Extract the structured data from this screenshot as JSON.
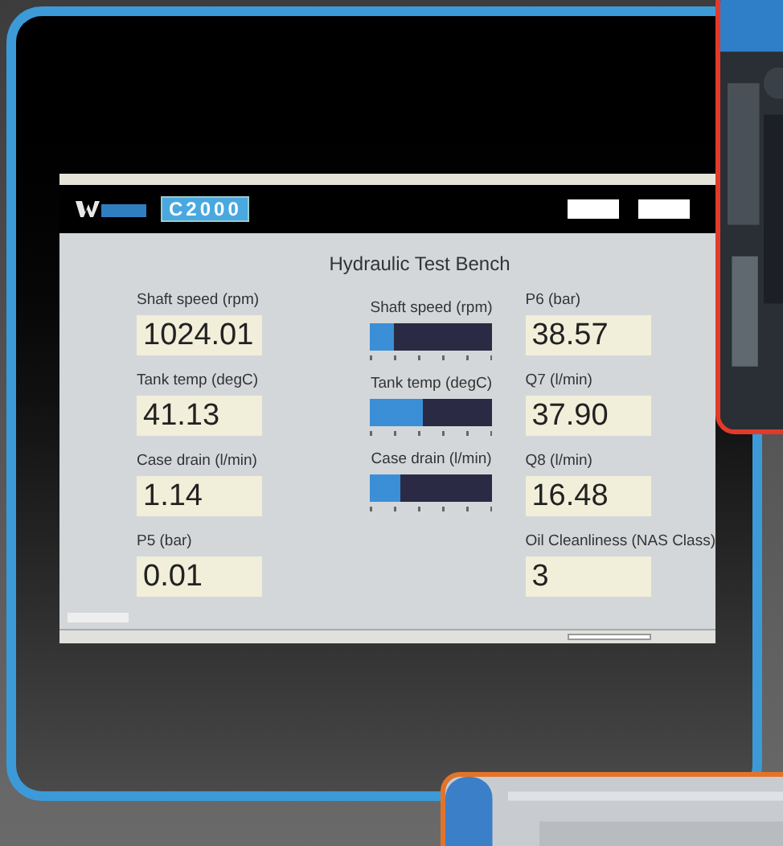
{
  "app": {
    "logo_text": "C2000",
    "title": "Hydraulic Test Bench"
  },
  "left_readings": [
    {
      "label": "Shaft speed (rpm)",
      "value": "1024.01"
    },
    {
      "label": "Tank temp (degC)",
      "value": "41.13"
    },
    {
      "label": "Case drain (l/min)",
      "value": "1.14"
    },
    {
      "label": "P5 (bar)",
      "value": "0.01"
    }
  ],
  "gauges": [
    {
      "label": "Shaft speed (rpm)",
      "level": 0.2
    },
    {
      "label": "Tank temp (degC)",
      "level": 0.43
    },
    {
      "label": "Case drain (l/min)",
      "level": 0.25
    }
  ],
  "right_readings": [
    {
      "label": "P6 (bar)",
      "value": "38.57"
    },
    {
      "label": "Q7 (l/min)",
      "value": "37.90"
    },
    {
      "label": "Q8 (l/min)",
      "value": "16.48"
    },
    {
      "label": "Oil Cleanliness (NAS Class)",
      "value": "3"
    }
  ]
}
